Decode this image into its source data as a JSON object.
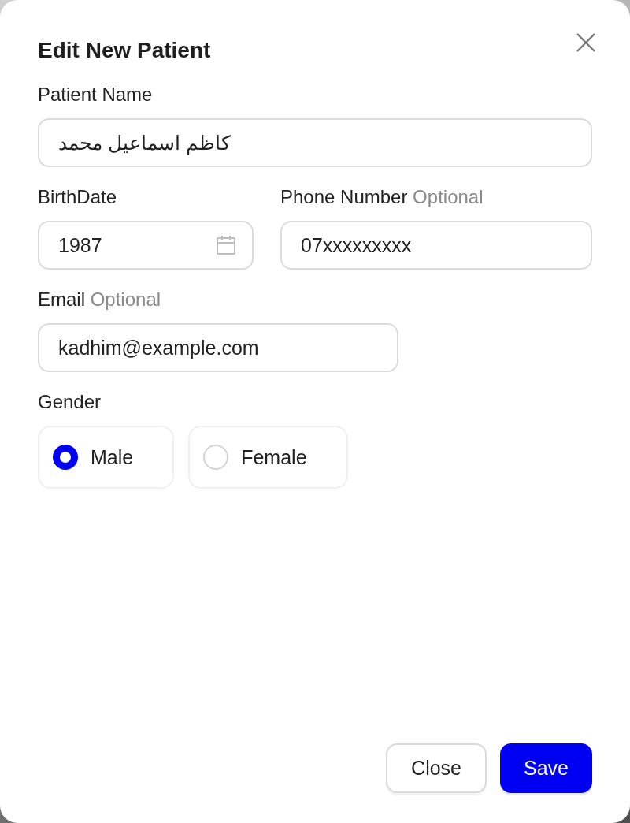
{
  "dialog": {
    "title": "Edit New Patient"
  },
  "fields": [
    {
      "kind": "text",
      "label": "Patient Name",
      "value": "كاظم اسماعيل محمد"
    },
    {
      "kind": "date",
      "label": "BirthDate",
      "value": "1987"
    },
    {
      "kind": "text",
      "label": "Phone Number",
      "optional": "Optional",
      "value": "07xxxxxxxxx"
    },
    {
      "kind": "text",
      "label": "Email",
      "optional": "Optional",
      "value": "kadhim@example.com"
    }
  ],
  "gender": {
    "label": "Gender",
    "options": [
      {
        "label": "Male",
        "selected": true
      },
      {
        "label": "Female",
        "selected": false
      }
    ]
  },
  "buttons": [
    {
      "kind": "secondary",
      "label": "Close"
    },
    {
      "kind": "primary",
      "label": "Save"
    }
  ]
}
